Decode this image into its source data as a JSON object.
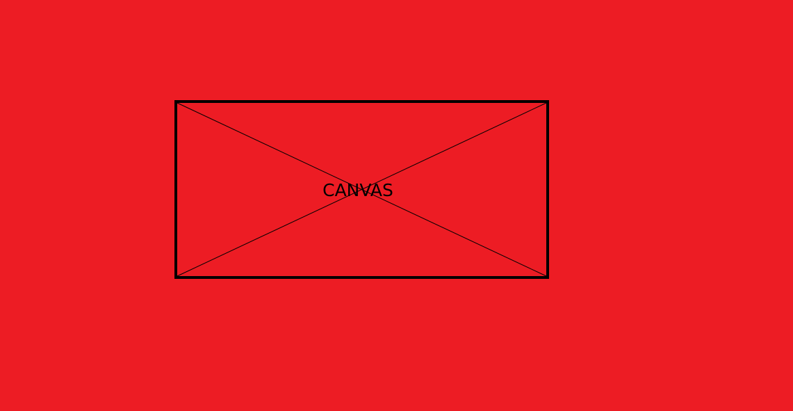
{
  "colors": {
    "background": "#ED1C24",
    "stroke": "#000000",
    "text": "#000000"
  },
  "canvas": {
    "label": "CANVAS"
  }
}
